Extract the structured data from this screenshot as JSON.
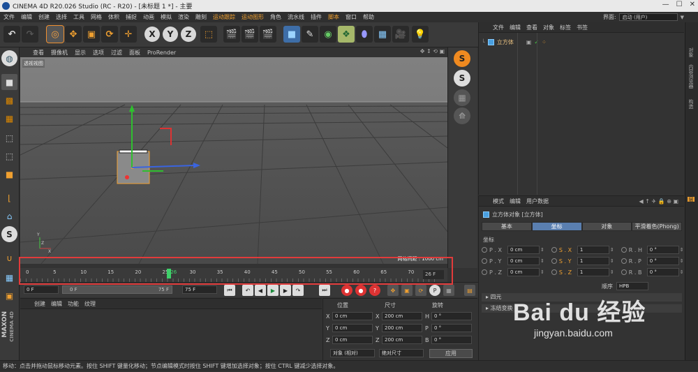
{
  "titlebar": {
    "title": "CINEMA 4D R20.026 Studio (RC - R20) - [未标题 1 *] - 主要",
    "min": "—",
    "max": "☐",
    "close": "✕"
  },
  "menubar": {
    "items": [
      "文件",
      "编辑",
      "创建",
      "选择",
      "工具",
      "网格",
      "体积",
      "捕捉",
      "动画",
      "模拟",
      "渲染",
      "雕刻",
      "运动跟踪",
      "运动图形",
      "角色",
      "流水线",
      "插件",
      "脚本",
      "窗口",
      "帮助"
    ],
    "layout_label": "界面:",
    "layout_value": "启动 (用户)"
  },
  "toolbar": {
    "undo": "↶",
    "redo": "↷",
    "x": "X",
    "y": "Y",
    "z": "Z"
  },
  "viewport": {
    "menu": [
      "查看",
      "摄像机",
      "显示",
      "选项",
      "过滤",
      "面板",
      "ProRender"
    ],
    "label": "透视视图",
    "grid_info": "网格间距 : 1000 cm",
    "nav_icons": "✥ ↕ ⟲ ▣"
  },
  "objects_panel": {
    "menu": [
      "文件",
      "编辑",
      "查看",
      "对象",
      "标签",
      "书签"
    ],
    "object_name": "立方体"
  },
  "side_tabs": [
    "对象",
    "内容浏览器",
    "构造",
    "层"
  ],
  "attributes": {
    "menu": [
      "模式",
      "编辑",
      "用户数据"
    ],
    "object_title": "立方体对象 [立方体]",
    "tabs": [
      "基本",
      "坐标",
      "对象",
      "平滑着色(Phong)"
    ],
    "section_title": "坐标",
    "rows": [
      {
        "p_label": "P . X",
        "p_val": "0 cm",
        "s_label": "S . X",
        "s_val": "1",
        "r_label": "R . H",
        "r_val": "0 °"
      },
      {
        "p_label": "P . Y",
        "p_val": "0 cm",
        "s_label": "S . Y",
        "s_val": "1",
        "r_label": "R . P",
        "r_val": "0 °"
      },
      {
        "p_label": "P . Z",
        "p_val": "0 cm",
        "s_label": "S . Z",
        "s_val": "1",
        "r_label": "R . B",
        "r_val": "0 °"
      }
    ],
    "order_label": "顺序",
    "order_value": "HPB",
    "section_quat": "四元",
    "section_freeze": "冻结变换"
  },
  "timeline": {
    "ticks": [
      "0",
      "5",
      "10",
      "15",
      "20",
      "25",
      "26",
      "30",
      "35",
      "40",
      "45",
      "50",
      "55",
      "60",
      "65",
      "70",
      "75"
    ],
    "end_frame": "26 F"
  },
  "playbar": {
    "start": "0 F",
    "range_start": "0 F",
    "range_end": "75 F",
    "end": "75 F"
  },
  "materials": {
    "menu": [
      "创建",
      "编辑",
      "功能",
      "纹理"
    ]
  },
  "coordinates": {
    "headers": [
      "位置",
      "尺寸",
      "旋转"
    ],
    "rows": [
      {
        "p": "X",
        "pv": "0 cm",
        "s": "X",
        "sv": "200 cm",
        "r": "H",
        "rv": "0 °"
      },
      {
        "p": "Y",
        "pv": "0 cm",
        "s": "Y",
        "sv": "200 cm",
        "r": "P",
        "rv": "0 °"
      },
      {
        "p": "Z",
        "pv": "0 cm",
        "s": "Z",
        "sv": "200 cm",
        "r": "B",
        "rv": "0 °"
      }
    ],
    "mode": "对象 (相对)",
    "size_mode": "绝对尺寸",
    "apply": "应用"
  },
  "status": "移动：点击并拖动鼠标移动元素。按住 SHIFT 键量化移动；节点编辑模式时按住 SHIFT 键增加选择对象；按住 CTRL 键减少选择对象。",
  "maxon": {
    "brand": "MAXON",
    "product": "CINEMA 4D"
  },
  "watermark": {
    "logo": "Bai du 经验",
    "url": "jingyan.baidu.com"
  }
}
